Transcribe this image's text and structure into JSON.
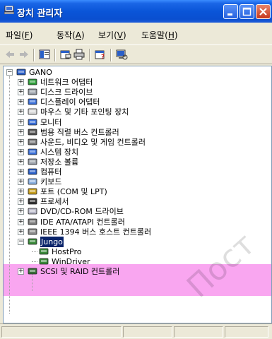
{
  "window": {
    "title": "장치 관리자"
  },
  "menu": [
    {
      "label": "파일",
      "key": "F"
    },
    {
      "label": "동작",
      "key": "A"
    },
    {
      "label": "보기",
      "key": "V"
    },
    {
      "label": "도움말",
      "key": "H"
    }
  ],
  "toolbar": {
    "icons": [
      "back-arrow-icon",
      "forward-arrow-icon",
      "console-tree-icon",
      "properties-icon",
      "print-icon",
      "help-icon",
      "scan-hardware-icon"
    ]
  },
  "tree": {
    "root": "GANO",
    "categories": [
      {
        "label": "네트워크 어댑터",
        "icon": "network-adapter-icon"
      },
      {
        "label": "디스크 드라이브",
        "icon": "disk-drive-icon"
      },
      {
        "label": "디스플레이 어댑터",
        "icon": "display-adapter-icon"
      },
      {
        "label": "마우스 및 기타 포인팅 장치",
        "icon": "mouse-icon"
      },
      {
        "label": "모니터",
        "icon": "monitor-icon"
      },
      {
        "label": "범용 직렬 버스 컨트롤러",
        "icon": "usb-icon"
      },
      {
        "label": "사운드, 비디오 및 게임 컨트롤러",
        "icon": "sound-icon"
      },
      {
        "label": "시스템 장치",
        "icon": "system-device-icon"
      },
      {
        "label": "저장소 볼륨",
        "icon": "storage-volume-icon"
      },
      {
        "label": "컴퓨터",
        "icon": "computer-icon"
      },
      {
        "label": "키보드",
        "icon": "keyboard-icon"
      },
      {
        "label": "포트 (COM 및 LPT)",
        "icon": "port-icon"
      },
      {
        "label": "프로세서",
        "icon": "processor-icon"
      },
      {
        "label": "DVD/CD-ROM 드라이브",
        "icon": "cdrom-icon"
      },
      {
        "label": "IDE ATA/ATAPI 컨트롤러",
        "icon": "ide-controller-icon"
      },
      {
        "label": "IEEE 1394 버스 호스트 컨트롤러",
        "icon": "ieee1394-icon"
      }
    ],
    "jungo": {
      "label": "Jungo",
      "children": [
        "HostPro",
        "WinDriver"
      ]
    },
    "last": {
      "label": "SCSI 및 RAID 컨트롤러",
      "icon": "scsi-icon"
    }
  },
  "watermark": "Пост",
  "colors": {
    "titlebar": "#0a55d8",
    "highlight": "#f9a6f0",
    "selection": "#0a246a"
  }
}
